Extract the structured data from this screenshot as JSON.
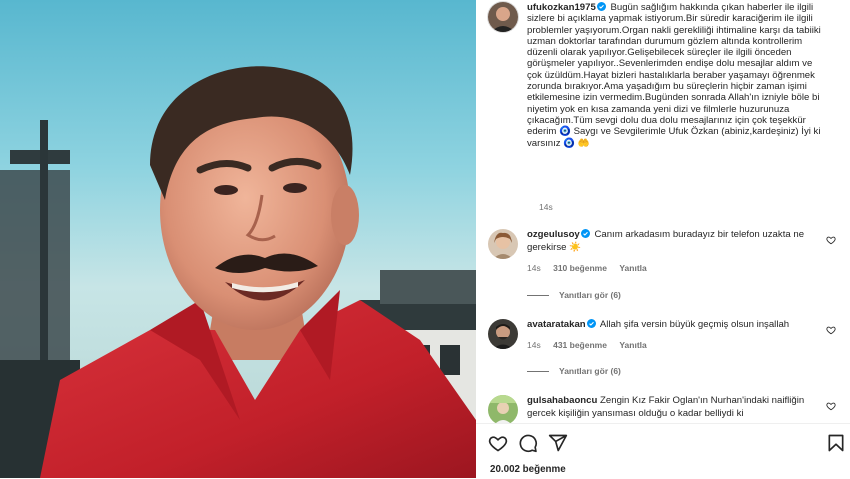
{
  "post": {
    "username": "ufukozkan1975",
    "caption": " Bugün sağlığım hakkında çıkan haberler ile ilgili sizlere bi açıklama yapmak istiyorum.Bir süredir karaciğerim ile ilgili problemler yaşıyorum.Organ nakli gerekliliği ihtimaline karşı da tabiiki uzman doktorlar tarafından durumum gözlem altında kontrollerim düzenli olarak yapılıyor.Gelişebilecek süreçler ile ilgili önceden görüşmeler yapılıyor..Sevenlerimden endişe dolu mesajlar aldım ve çok üzüldüm.Hayat bizleri hastalıklarla beraber yaşamayı öğrenmek zorunda bırakıyor.Ama yaşadığım bu süreçlerin hiçbir zaman işimi etkilemesine izin vermedim.Bugünden sonrada Allah'ın izniyle böle bi niyetim yok en kısa zamanda yeni dizi ve filmlerle huzurunuza çıkacağım.Tüm sevgi dolu dua dolu mesajlarınız için çok teşekkür ederim 🧿 Saygı ve Sevgilerimle Ufuk Özkan (abiniz,kardeşiniz) İyi ki varsınız 🧿 🤲",
    "time": "14s"
  },
  "comments": [
    {
      "username": "ozgeulusoy",
      "text": "Canım arkadasım buradayız bir telefon uzakta ne gerekirse ☀️",
      "time": "14s",
      "likes": "310 beğenme",
      "reply_label": "Yanıtla",
      "view_replies": "Yanıtları gör (6)"
    },
    {
      "username": "avataratakan",
      "text": "Allah şifa versin büyük geçmiş olsun inşallah",
      "time": "14s",
      "likes": "431 beğenme",
      "reply_label": "Yanıtla",
      "view_replies": "Yanıtları gör (6)"
    },
    {
      "username": "gulsahabaoncu",
      "text": "Zengin Kız Fakir Oglan'ın Nurhan'indaki naifliğin gercek kişiliğin yansıması olduğu o kadar belliydi ki"
    }
  ],
  "footer": {
    "likes": "20.002 beğenme"
  },
  "colors": {
    "verified": "#0095f6",
    "shirt": "#c8232c",
    "sky": "#6bc2d8"
  }
}
